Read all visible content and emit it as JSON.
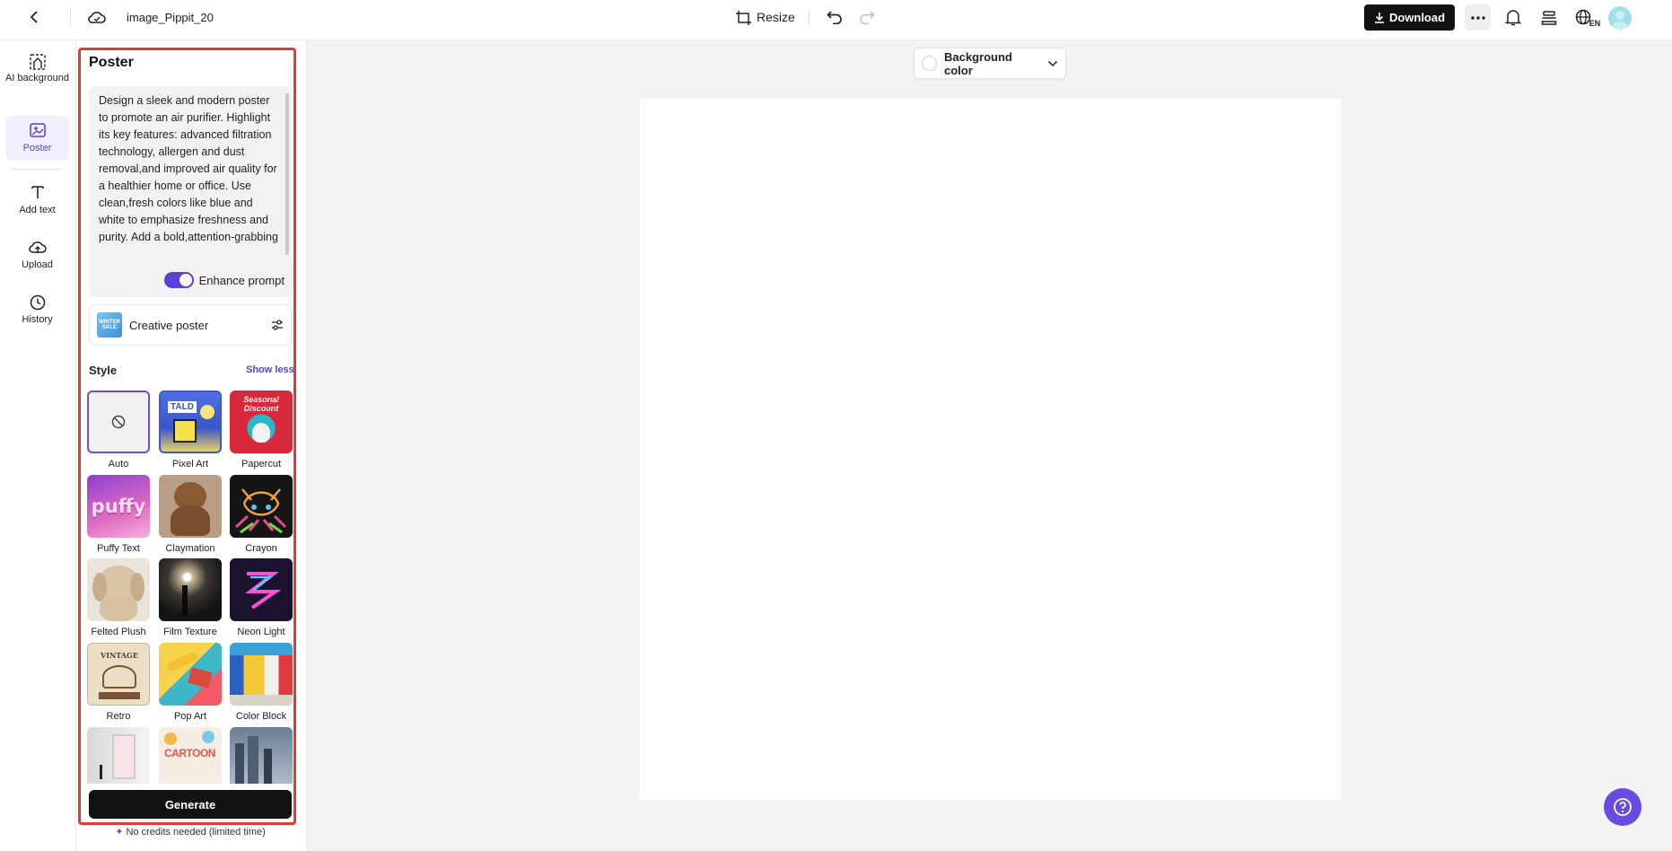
{
  "topbar": {
    "title": "image_Pippit_20",
    "resize_label": "Resize",
    "download_label": "Download",
    "language": "EN"
  },
  "rail": {
    "items": [
      {
        "label": "AI background",
        "icon": "ai-background-icon"
      },
      {
        "label": "Poster",
        "icon": "poster-icon"
      },
      {
        "label": "Add text",
        "icon": "text-icon"
      },
      {
        "label": "Upload",
        "icon": "upload-icon"
      },
      {
        "label": "History",
        "icon": "history-icon"
      }
    ]
  },
  "panel": {
    "title": "Poster",
    "prompt": "Design a sleek and modern poster to promote an air purifier. Highlight its key features: advanced filtration technology, allergen and dust removal,and improved air quality for a healthier home or office. Use clean,fresh colors like blue and white to emphasize freshness and purity. Add a bold,attention-grabbing",
    "enhance_label": "Enhance prompt",
    "enhance_on": true,
    "poster_type": "Creative poster",
    "poster_type_thumb": "WINTER SALE",
    "style_heading": "Style",
    "show_less": "Show less",
    "styles": [
      {
        "label": "Auto",
        "selected": true
      },
      {
        "label": "Pixel Art",
        "thumb_text": "TALD"
      },
      {
        "label": "Papercut",
        "thumb_text": "Seasonal Discount"
      },
      {
        "label": "Puffy Text",
        "thumb_text": "puffy"
      },
      {
        "label": "Claymation"
      },
      {
        "label": "Crayon"
      },
      {
        "label": "Felted Plush"
      },
      {
        "label": "Film Texture"
      },
      {
        "label": "Neon Light"
      },
      {
        "label": "Retro",
        "thumb_text": "VINTAGE"
      },
      {
        "label": "Pop Art"
      },
      {
        "label": "Color Block"
      },
      {
        "label": ""
      },
      {
        "label": "",
        "thumb_text": "CARTOON"
      },
      {
        "label": ""
      }
    ],
    "generate_label": "Generate",
    "credits_note": "No credits needed (limited time)"
  },
  "workspace": {
    "background_color_label": "Background color",
    "background_color": "#ffffff"
  },
  "colors": {
    "accent": "#5b3fd6",
    "highlight_frame": "#e53935"
  }
}
